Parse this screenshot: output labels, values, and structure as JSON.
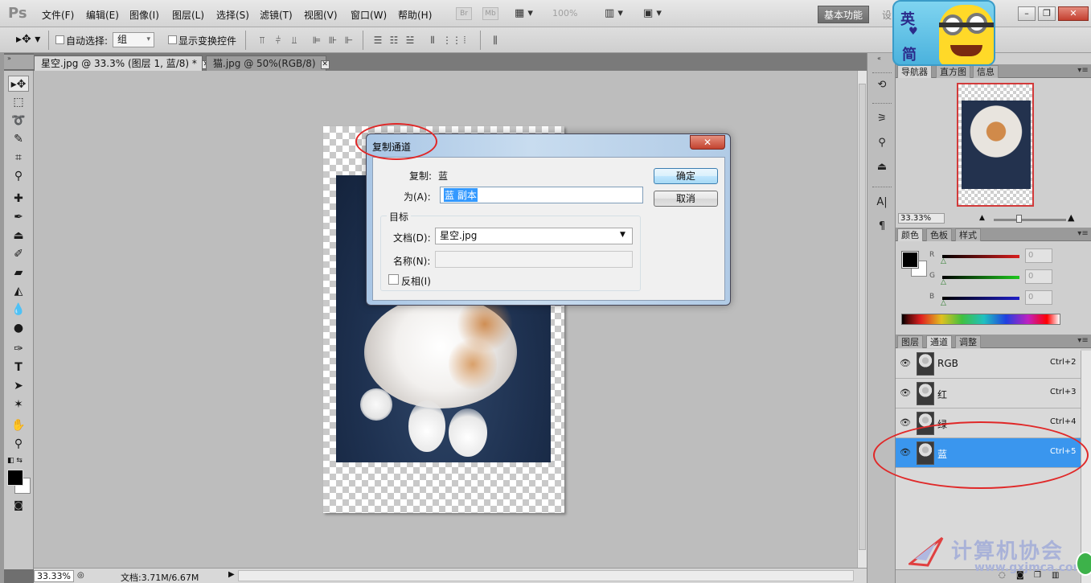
{
  "app": {
    "logo": "Ps"
  },
  "menubar": {
    "items": [
      "文件(F)",
      "编辑(E)",
      "图像(I)",
      "图层(L)",
      "选择(S)",
      "滤镜(T)",
      "视图(V)",
      "窗口(W)",
      "帮助(H)"
    ],
    "mini_buttons": [
      "Br",
      "Mb"
    ],
    "zoom": "100%",
    "workspace": "基本功能",
    "workspace_next": "设",
    "window_buttons": [
      "–",
      "❐",
      "✕"
    ]
  },
  "options": {
    "auto_select_label": "自动选择:",
    "auto_select_value": "组",
    "show_transform_label": "显示变换控件"
  },
  "tabs": [
    {
      "label": "星空.jpg @ 33.3% (图层 1, 蓝/8) *",
      "active": true
    },
    {
      "label": "猫.jpg @ 50%(RGB/8)",
      "active": false
    }
  ],
  "status": {
    "zoom": "33.33%",
    "doc_size": "文档:3.71M/6.67M"
  },
  "navigator": {
    "tabs": [
      "导航器",
      "直方图",
      "信息"
    ],
    "zoom": "33.33%"
  },
  "color_panel": {
    "tabs": [
      "颜色",
      "色板",
      "样式"
    ],
    "sliders": [
      {
        "label": "R",
        "value": "0",
        "color": "#d81e1e"
      },
      {
        "label": "G",
        "value": "0",
        "color": "#1ec81e"
      },
      {
        "label": "B",
        "value": "0",
        "color": "#1e1ec8"
      }
    ]
  },
  "channels_panel": {
    "tabs": [
      "图层",
      "通道",
      "调整"
    ],
    "rows": [
      {
        "name": "RGB",
        "shortcut": "Ctrl+2",
        "selected": false
      },
      {
        "name": "红",
        "shortcut": "Ctrl+3",
        "selected": false
      },
      {
        "name": "绿",
        "shortcut": "Ctrl+4",
        "selected": false
      },
      {
        "name": "蓝",
        "shortcut": "Ctrl+5",
        "selected": true
      }
    ]
  },
  "dialog": {
    "title": "复制通道",
    "close": "✕",
    "source_label": "复制:",
    "source_value": "蓝",
    "as_label": "为(A):",
    "as_value": "蓝 副本",
    "ok": "确定",
    "cancel": "取消",
    "target_group": "目标",
    "document_label": "文档(D):",
    "document_value": "星空.jpg",
    "name_label": "名称(N):",
    "invert_label": "反相(I)"
  },
  "badge": {
    "line1": "英",
    "line2": "简"
  },
  "watermark": {
    "title": "计算机协会",
    "url": "www.gxjmca.com"
  }
}
